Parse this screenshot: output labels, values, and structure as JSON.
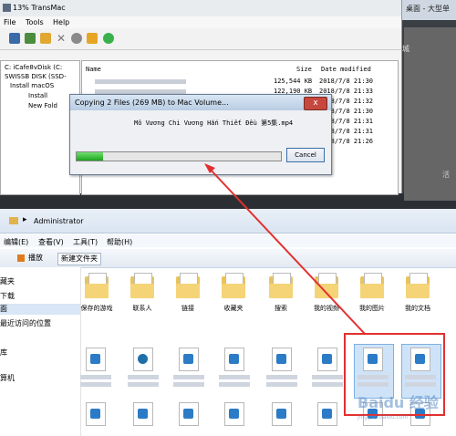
{
  "background_window": {
    "title": "桌面 - 大型单",
    "side_text": "城",
    "mid_text": "活",
    "controls": [
      "–",
      "□",
      "x"
    ]
  },
  "transmac": {
    "title": "13% TransMac",
    "menu": [
      "File",
      "Tools",
      "Help"
    ],
    "tree": [
      "C: iCafe8vDisk (C:",
      "SWISSB DISK (SSD-",
      "Install macOS",
      "Install",
      "New Fold"
    ],
    "list_header": {
      "name": "Name",
      "size": "Size",
      "date": "Date modified"
    },
    "rows": [
      {
        "size": "125,544 KB",
        "date": "2018/7/8 21:30"
      },
      {
        "size": "122,190 KB",
        "date": "2018/7/8 21:33"
      },
      {
        "size": "",
        "date": "2018/7/8 21:32"
      },
      {
        "size": "",
        "date": "2018/7/8 21:30"
      },
      {
        "size": "",
        "date": "2018/7/8 21:31"
      },
      {
        "size": "",
        "date": "2018/7/8 21:31"
      },
      {
        "size": "",
        "date": "2018/7/8 21:26"
      }
    ]
  },
  "dialog": {
    "title": "Copying 2 Files (269 MB) to Mac Volume...",
    "close": "x",
    "filename": "Mô Vương Chi Vương   Hắn Thiết Đều   第5集.mp4",
    "progress": 0.13,
    "cancel": "Cancel"
  },
  "explorer": {
    "breadcrumb": "Administrator",
    "menu": [
      "编辑(E)",
      "查看(V)",
      "工具(T)",
      "帮助(H)"
    ],
    "commands": [
      "播放",
      "新建文件夹"
    ],
    "nav": [
      "藏夹",
      "下载",
      "面",
      "最近访问的位置",
      "库",
      "算机"
    ],
    "folders": [
      "保存的游戏",
      "联系人",
      "链接",
      "收藏夹",
      "搜索",
      "我的视频",
      "我的图片",
      "我的文档"
    ],
    "watermark": "Baidu 经验",
    "watermark_sub": "jingyan.baidu.com"
  },
  "colors": {
    "progress": "#27b027",
    "highlight": "#e23030"
  }
}
